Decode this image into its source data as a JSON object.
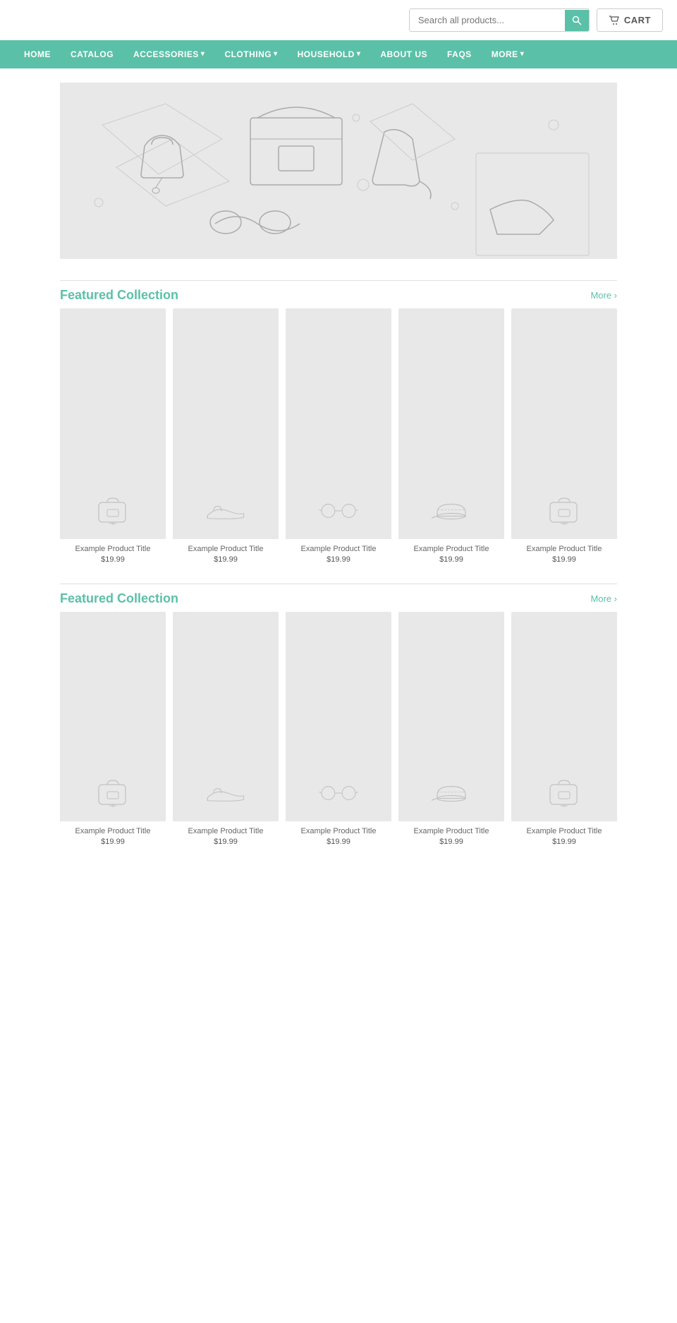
{
  "header": {
    "search_placeholder": "Search all products...",
    "cart_label": "CART"
  },
  "nav": {
    "items": [
      {
        "label": "HOME",
        "has_dropdown": false
      },
      {
        "label": "CATALOG",
        "has_dropdown": false
      },
      {
        "label": "ACCESSORIES",
        "has_dropdown": true
      },
      {
        "label": "CLOTHING",
        "has_dropdown": true
      },
      {
        "label": "HOUSEHOLD",
        "has_dropdown": true
      },
      {
        "label": "ABOUT US",
        "has_dropdown": false
      },
      {
        "label": "FAQS",
        "has_dropdown": false
      },
      {
        "label": "MORE",
        "has_dropdown": true
      }
    ]
  },
  "featured1": {
    "title": "Featured Collection",
    "more_label": "More ›",
    "products": [
      {
        "title": "Example Product Title",
        "price": "$19.99",
        "icon": "backpack"
      },
      {
        "title": "Example Product Title",
        "price": "$19.99",
        "icon": "shoe"
      },
      {
        "title": "Example Product Title",
        "price": "$19.99",
        "icon": "glasses"
      },
      {
        "title": "Example Product Title",
        "price": "$19.99",
        "icon": "cap"
      },
      {
        "title": "Example Product Title",
        "price": "$19.99",
        "icon": "backpack"
      }
    ]
  },
  "featured2": {
    "title": "Featured Collection",
    "more_label": "More ›",
    "products": [
      {
        "title": "Example Product Title",
        "price": "$19.99",
        "icon": "backpack"
      },
      {
        "title": "Example Product Title",
        "price": "$19.99",
        "icon": "shoe"
      },
      {
        "title": "Example Product Title",
        "price": "$19.99",
        "icon": "glasses"
      },
      {
        "title": "Example Product Title",
        "price": "$19.99",
        "icon": "cap"
      },
      {
        "title": "Example Product Title",
        "price": "$19.99",
        "icon": "backpack"
      }
    ]
  },
  "colors": {
    "teal": "#5bc0a8",
    "light_gray": "#e8e8e8"
  }
}
